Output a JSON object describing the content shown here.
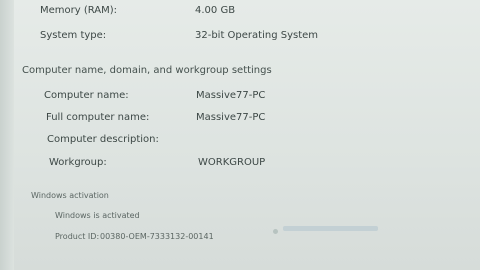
{
  "system": {
    "memory_label": "Memory (RAM):",
    "memory_value": "4.00 GB",
    "type_label": "System type:",
    "type_value": "32-bit Operating System"
  },
  "computer": {
    "heading": "Computer name, domain, and workgroup settings",
    "name_label": "Computer name:",
    "name_value": "Massive77-PC",
    "full_name_label": "Full computer name:",
    "full_name_value": "Massive77-PC",
    "description_label": "Computer description:",
    "description_value": "",
    "workgroup_label": "Workgroup:",
    "workgroup_value": "WORKGROUP"
  },
  "activation": {
    "heading": "Windows activation",
    "status": "Windows is activated",
    "product_id_label": "Product ID:",
    "product_id_value": "00380-OEM-7333132-00141"
  }
}
